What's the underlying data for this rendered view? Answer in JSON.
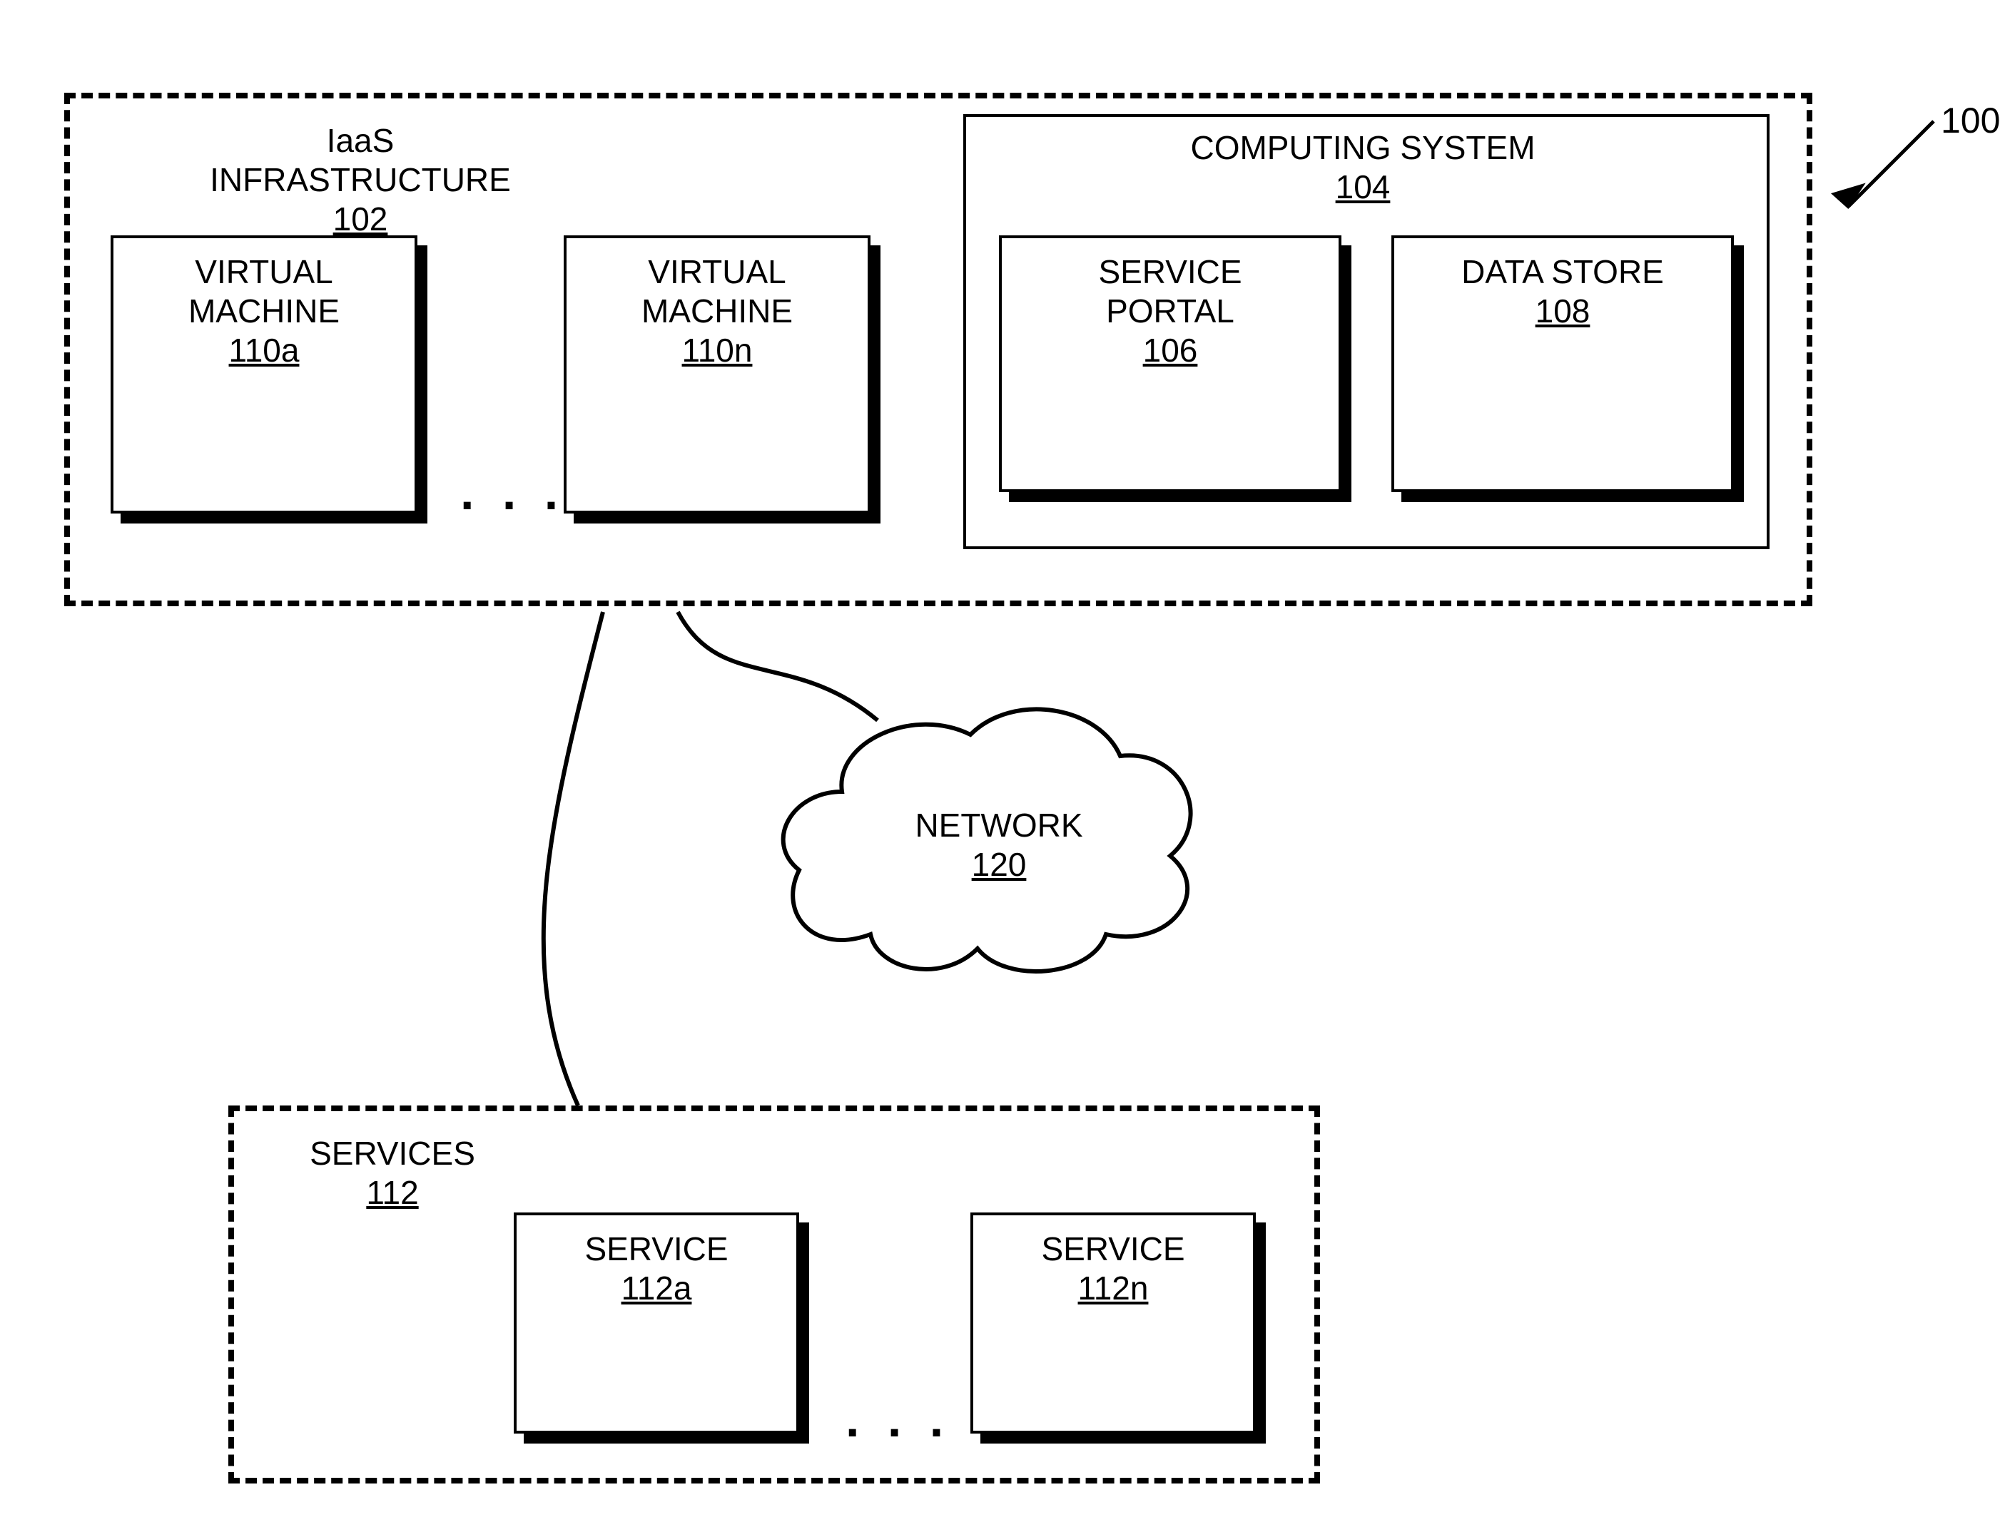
{
  "figure_ref": "100",
  "iaas": {
    "title": "IaaS INFRASTRUCTURE",
    "ref": "102",
    "vm_a": {
      "title": "VIRTUAL MACHINE",
      "ref": "110a"
    },
    "vm_n": {
      "title": "VIRTUAL MACHINE",
      "ref": "110n"
    },
    "ellipsis": ". . ."
  },
  "computing": {
    "title": "COMPUTING SYSTEM",
    "ref": "104",
    "portal": {
      "title": "SERVICE PORTAL",
      "ref": "106"
    },
    "datastore": {
      "title": "DATA STORE",
      "ref": "108"
    }
  },
  "network": {
    "title": "NETWORK",
    "ref": "120"
  },
  "services": {
    "title": "SERVICES",
    "ref": "112",
    "svc_a": {
      "title": "SERVICE",
      "ref": "112a"
    },
    "svc_n": {
      "title": "SERVICE",
      "ref": "112n"
    },
    "ellipsis": ". . ."
  }
}
